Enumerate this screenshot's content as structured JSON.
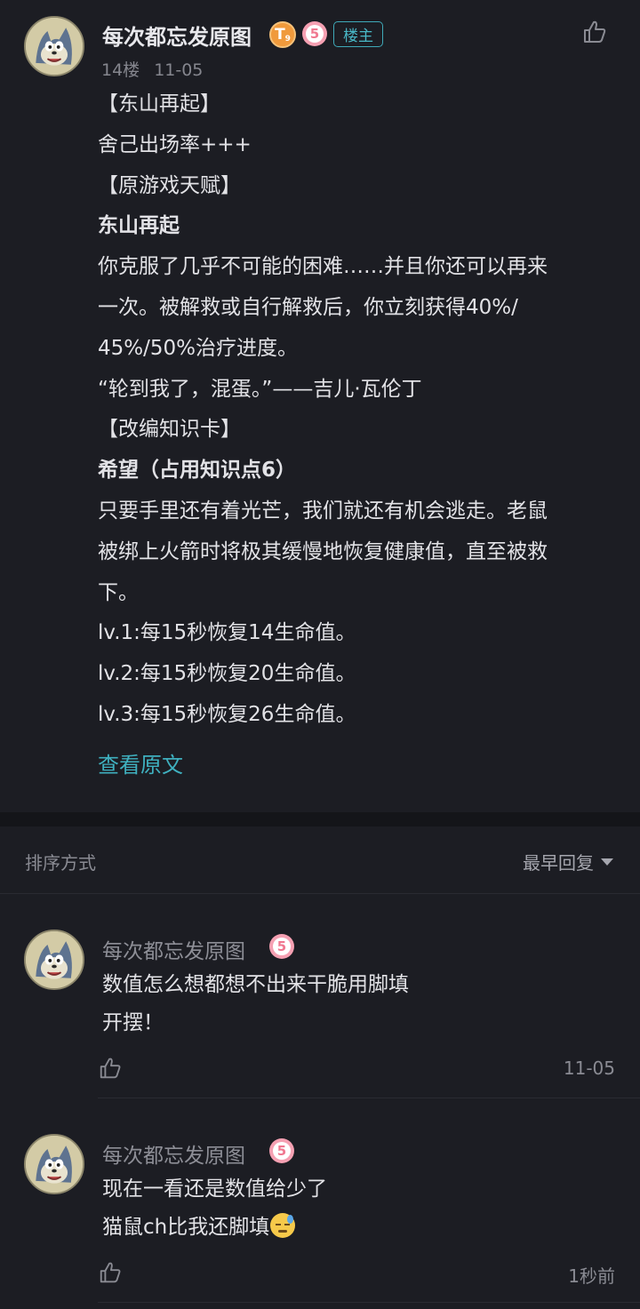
{
  "post": {
    "author": "每次都忘发原图",
    "level_badge": "T",
    "level_sub": "9",
    "five_badge": "5",
    "op_tag": "楼主",
    "floor": "14楼",
    "date": "11-05",
    "lines": [
      "【东山再起】",
      "舍己出场率+++",
      "【原游戏天赋】",
      "东山再起",
      "你克服了几乎不可能的困难……并且你还可以再来",
      "一次。被解救或自行解救后，你立刻获得40%/",
      "45%/50%治疗进度。",
      "“轮到我了，混蛋。”——吉儿·瓦伦丁",
      "【改编知识卡】",
      "希望（占用知识点6）",
      "只要手里还有着光芒，我们就还有机会逃走。老鼠",
      "被绑上火箭时将极其缓慢地恢复健康值，直至被救",
      "下。",
      "lv.1:每15秒恢复14生命值。",
      "lv.2:每15秒恢复20生命值。",
      "lv.3:每15秒恢复26生命值。"
    ],
    "view_original": "查看原文",
    "like_icon": "thumbs-up-icon"
  },
  "sort": {
    "label": "排序方式",
    "value": "最早回复"
  },
  "replies": [
    {
      "author": "每次都忘发原图",
      "five_badge": "5",
      "lines": [
        "数值怎么想都想不出来干脆用脚填",
        "开摆！"
      ],
      "time": "11-05"
    },
    {
      "author": "每次都忘发原图",
      "five_badge": "5",
      "lines": [
        "现在一看还是数值给少了",
        "猫鼠ch比我还脚填"
      ],
      "emoji": "downcast-sweat-emoji",
      "time": "1秒前"
    }
  ],
  "colors": {
    "background": "#1c1d23",
    "accent": "#3fb0bf",
    "level_badge": "#f09a3c",
    "five_badge": "#f5a0b2"
  }
}
